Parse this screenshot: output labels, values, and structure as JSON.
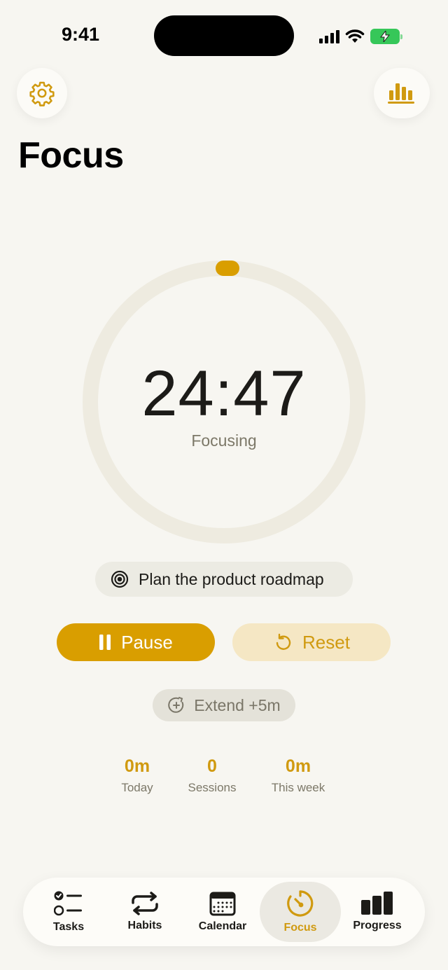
{
  "status_bar": {
    "time": "9:41"
  },
  "header": {
    "title": "Focus"
  },
  "timer": {
    "value": "24:47",
    "status": "Focusing",
    "progress": 0.0
  },
  "task": {
    "label": "Plan the product roadmap"
  },
  "controls": {
    "pause_label": "Pause",
    "reset_label": "Reset",
    "extend_label": "Extend +5m"
  },
  "stats": [
    {
      "value": "0m",
      "label": "Today"
    },
    {
      "value": "0",
      "label": "Sessions"
    },
    {
      "value": "0m",
      "label": "This week"
    }
  ],
  "tabs": [
    {
      "label": "Tasks",
      "icon": "tasks-icon",
      "active": false
    },
    {
      "label": "Habits",
      "icon": "repeat-icon",
      "active": false
    },
    {
      "label": "Calendar",
      "icon": "calendar-icon",
      "active": false
    },
    {
      "label": "Focus",
      "icon": "timer-icon",
      "active": true
    },
    {
      "label": "Progress",
      "icon": "bar-chart-icon",
      "active": false
    }
  ],
  "colors": {
    "accent": "#d99e00",
    "background": "#f7f6f1",
    "ring_track": "#eeebe0",
    "battery": "#36c759"
  }
}
